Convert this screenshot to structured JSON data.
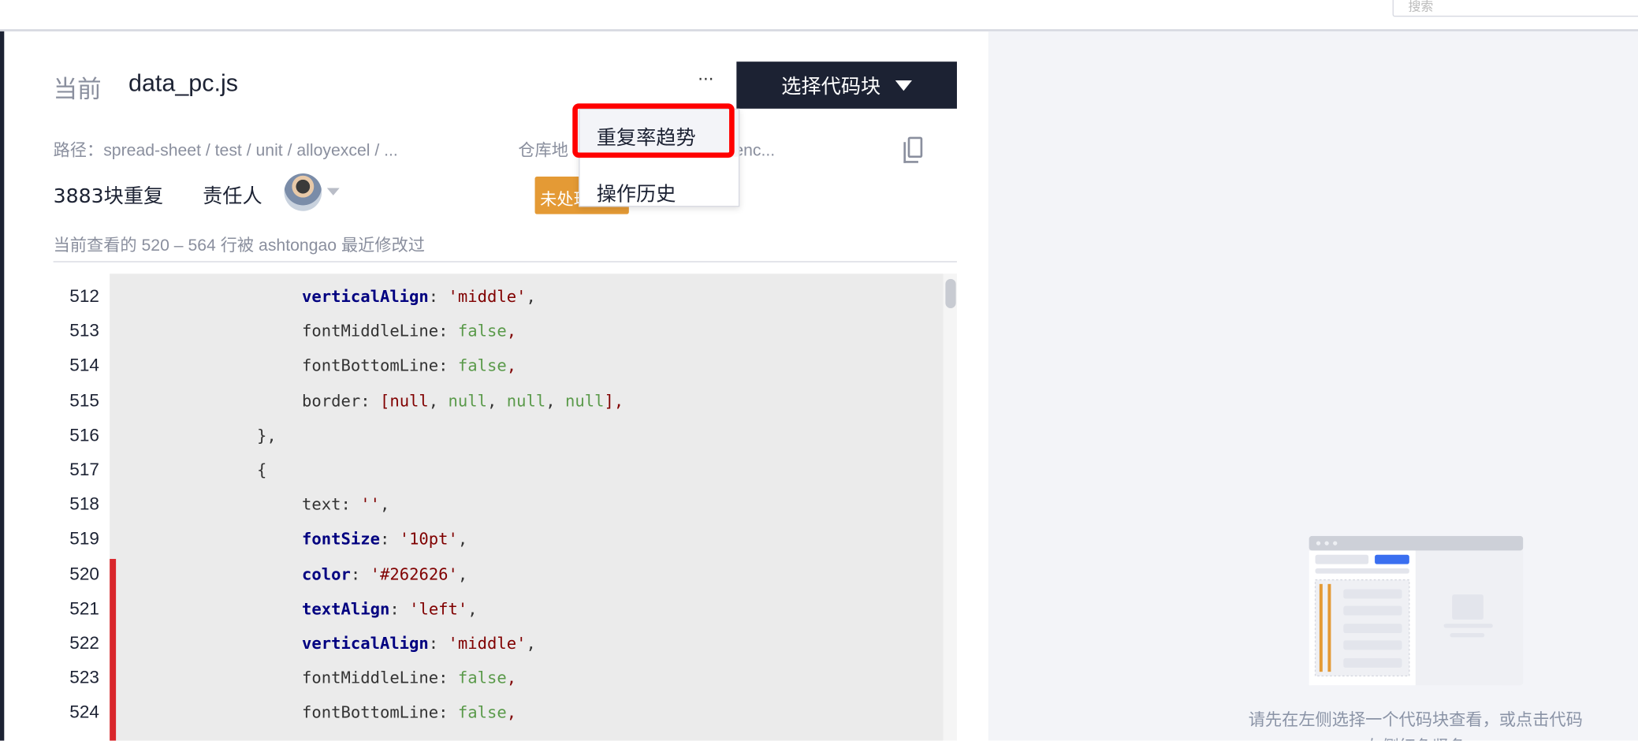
{
  "topbar": {
    "search_placeholder": "搜索"
  },
  "header": {
    "title_prefix": "当前",
    "file_name": "data_pc.js",
    "more_label": "···",
    "select_button": "选择代码块"
  },
  "meta": {
    "path": "路径：spread-sheet / test / unit / alloyexcel / ...",
    "repo_label": "仓库地",
    "repo_url": "e.oa.com/tenc...",
    "duplicates": "3883块重复",
    "owner_label": "责任人",
    "status": "未处理",
    "recent": "当前查看的 520 – 564 行被 ashtongao 最近修改过"
  },
  "menu": {
    "items": [
      "重复率趋势",
      "操作历史"
    ]
  },
  "code": {
    "lines": [
      {
        "n": "512",
        "indent": 2,
        "parts": [
          [
            "k",
            "verticalAlign"
          ],
          [
            "",
            "': "
          ],
          [
            "s",
            "'middle'"
          ],
          [
            "",
            ","
          ]
        ]
      },
      {
        "n": "513",
        "indent": 2,
        "parts": [
          [
            "",
            "fontMiddleLine: "
          ],
          [
            "g",
            "false"
          ],
          [
            "s",
            ","
          ]
        ]
      },
      {
        "n": "514",
        "indent": 2,
        "parts": [
          [
            "",
            "fontBottomLine: "
          ],
          [
            "g",
            "false"
          ],
          [
            "s",
            ","
          ]
        ]
      },
      {
        "n": "515",
        "indent": 2,
        "parts": [
          [
            "",
            "border: "
          ],
          [
            "s",
            "[null"
          ],
          [
            "",
            ", "
          ],
          [
            "g",
            "null"
          ],
          [
            "",
            ", "
          ],
          [
            "g",
            "null"
          ],
          [
            "",
            ", "
          ],
          [
            "g",
            "null"
          ],
          [
            "s",
            "],"
          ]
        ]
      },
      {
        "n": "516",
        "indent": 1,
        "parts": [
          [
            "",
            "},"
          ]
        ]
      },
      {
        "n": "517",
        "indent": 1,
        "parts": [
          [
            "",
            "{"
          ]
        ]
      },
      {
        "n": "518",
        "indent": 2,
        "parts": [
          [
            "",
            "text: "
          ],
          [
            "s",
            "''"
          ],
          [
            "",
            ","
          ]
        ]
      },
      {
        "n": "519",
        "indent": 2,
        "parts": [
          [
            "k",
            "fontSize"
          ],
          [
            "",
            ": "
          ],
          [
            "s",
            "'10pt'"
          ],
          [
            "",
            ","
          ]
        ]
      },
      {
        "n": "520",
        "indent": 2,
        "parts": [
          [
            "k",
            "color"
          ],
          [
            "",
            ": "
          ],
          [
            "s",
            "'#262626'"
          ],
          [
            "",
            ","
          ]
        ]
      },
      {
        "n": "521",
        "indent": 2,
        "parts": [
          [
            "k",
            "textAlign"
          ],
          [
            "",
            ": "
          ],
          [
            "s",
            "'left'"
          ],
          [
            "",
            ","
          ]
        ]
      },
      {
        "n": "522",
        "indent": 2,
        "parts": [
          [
            "k",
            "verticalAlign"
          ],
          [
            "",
            ": "
          ],
          [
            "s",
            "'middle'"
          ],
          [
            "",
            ","
          ]
        ]
      },
      {
        "n": "523",
        "indent": 2,
        "parts": [
          [
            "",
            "fontMiddleLine: "
          ],
          [
            "g",
            "false"
          ],
          [
            "s",
            ","
          ]
        ]
      },
      {
        "n": "524",
        "indent": 2,
        "parts": [
          [
            "",
            "fontBottomLine: "
          ],
          [
            "g",
            "false"
          ],
          [
            "s",
            ","
          ]
        ]
      }
    ]
  },
  "right_panel": {
    "hint": "请先在左侧选择一个代码块查看，或点击代码左侧红色竖条"
  },
  "colors": {
    "dark": "#1c2233",
    "accent": "#3a6ff0",
    "warning": "#e49a35",
    "highlight": "#ff0000",
    "dup_bar": "#d9262b"
  }
}
